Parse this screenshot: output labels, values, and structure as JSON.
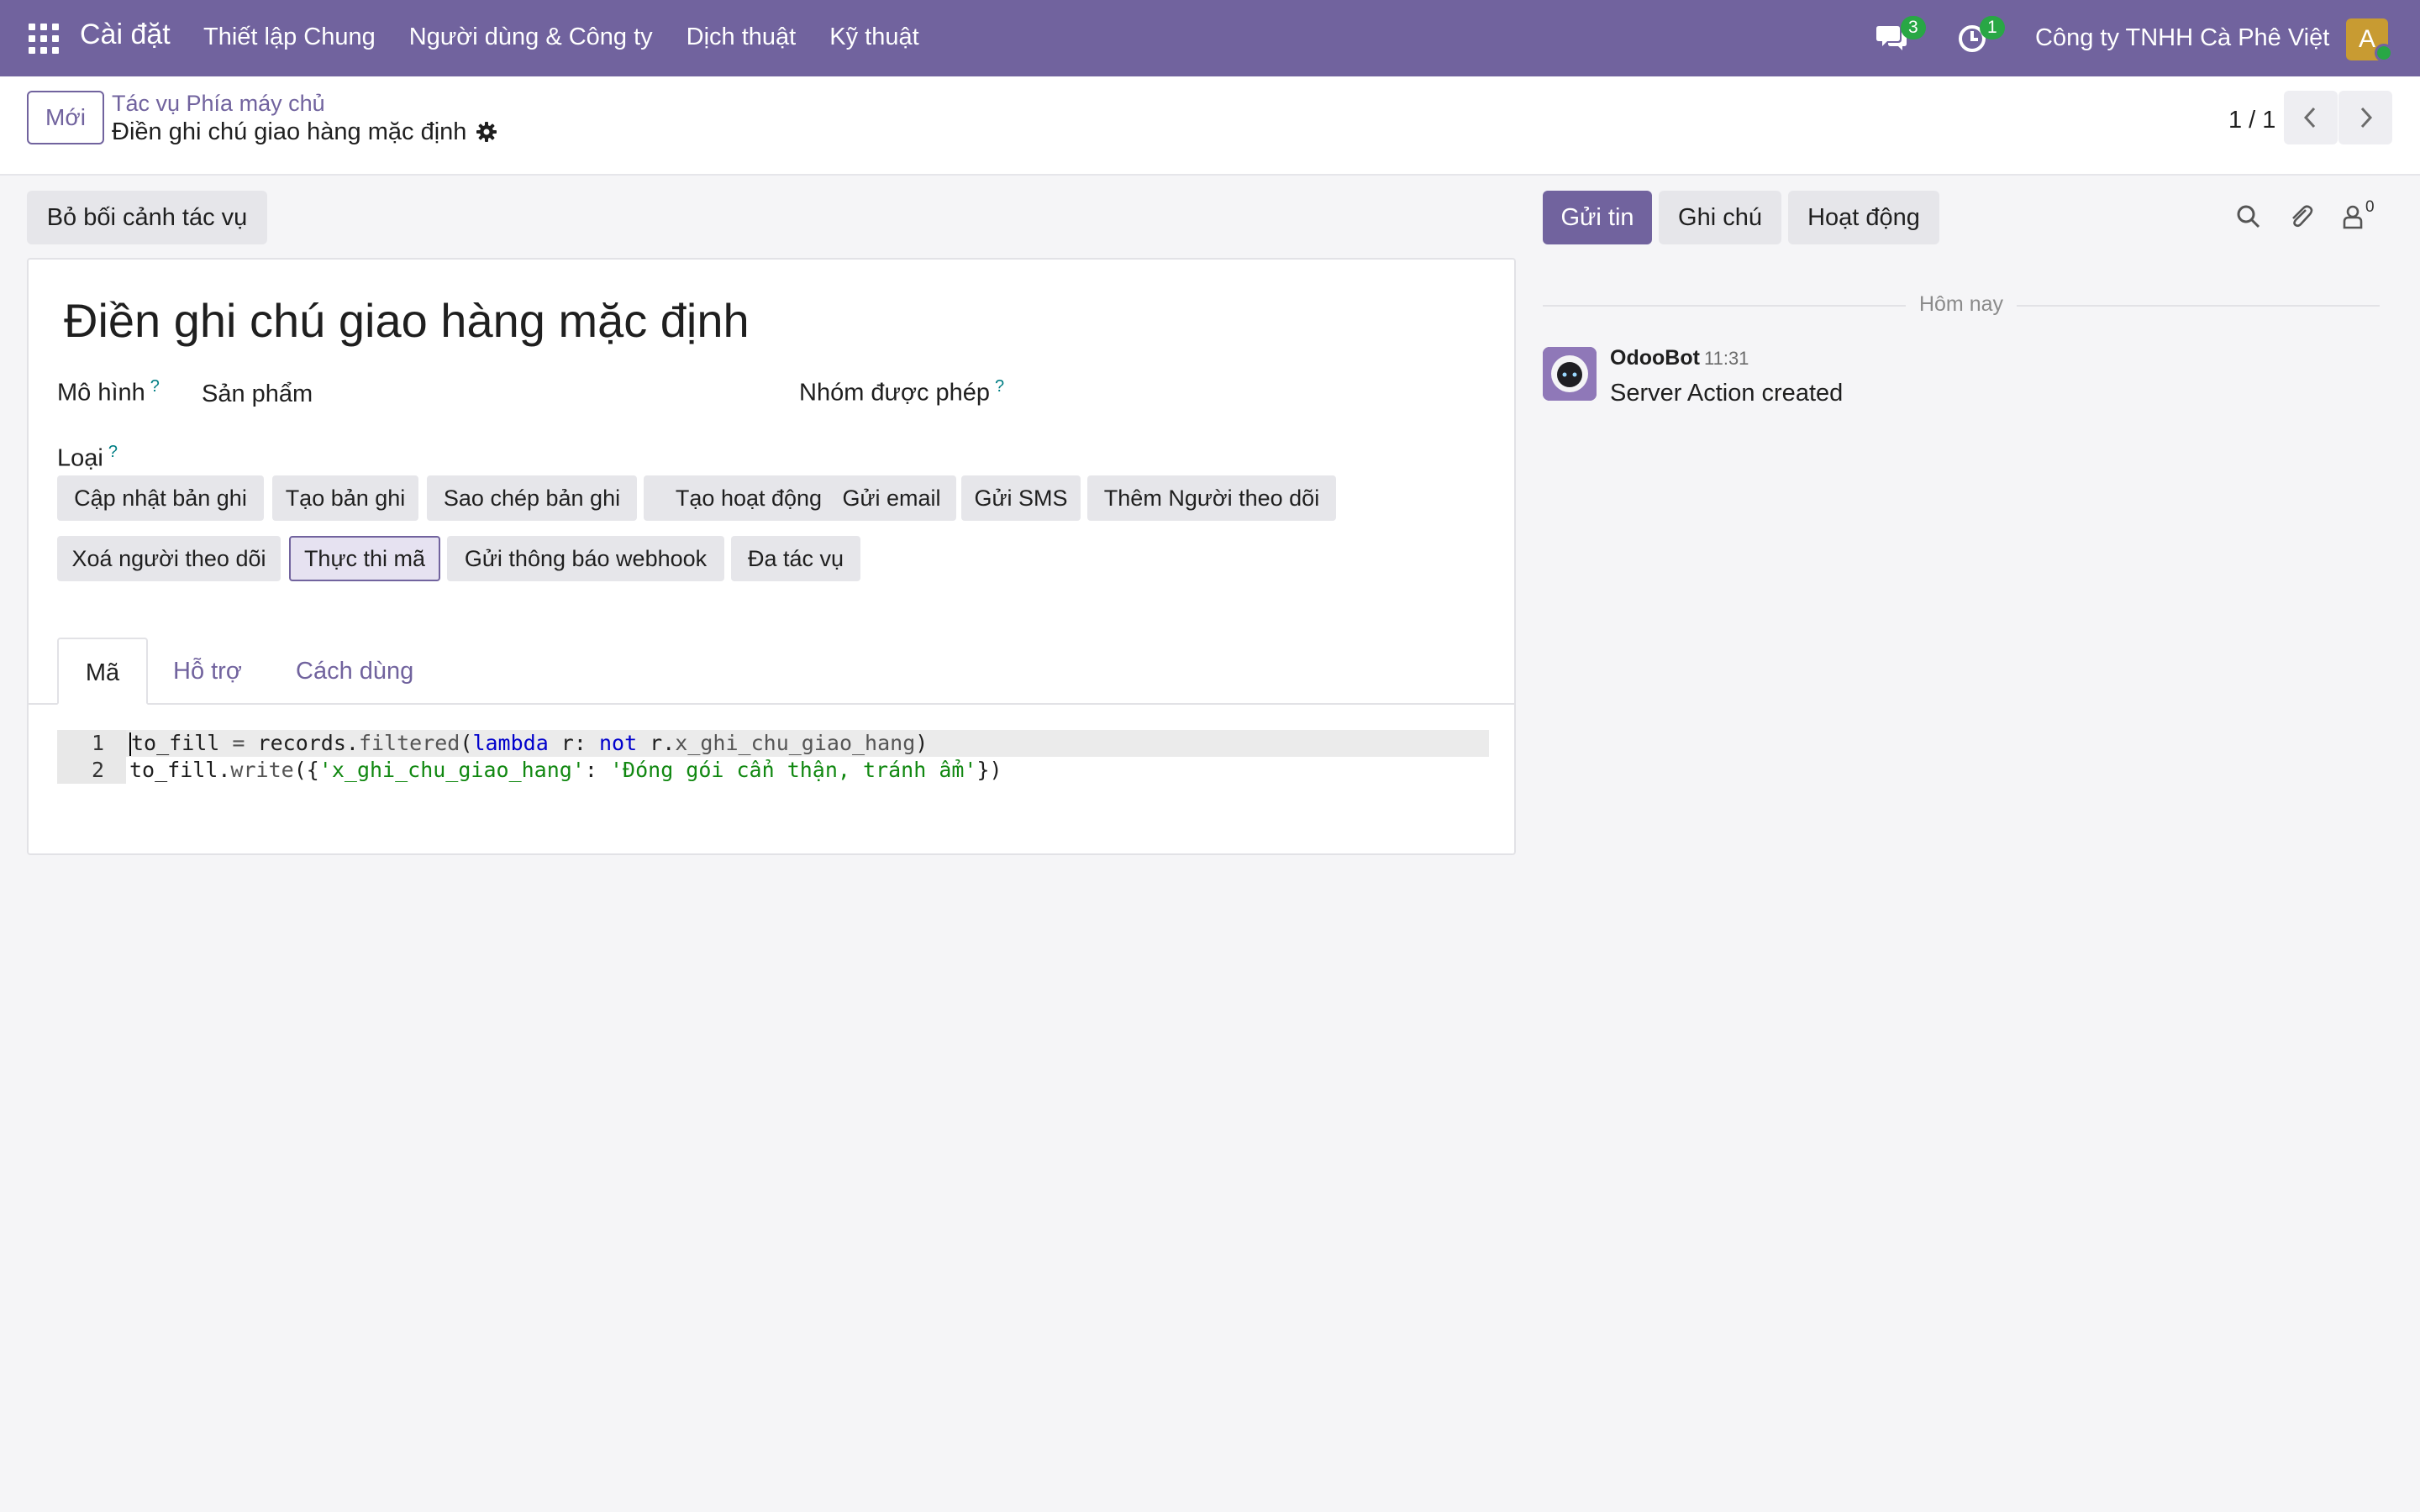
{
  "navbar": {
    "app_title": "Cài đặt",
    "menu": [
      "Thiết lập Chung",
      "Người dùng & Công ty",
      "Dịch thuật",
      "Kỹ thuật"
    ],
    "messages_count": "3",
    "activities_count": "1",
    "company": "Công ty TNHH Cà Phê Việt",
    "avatar_initial": "A",
    "accent_color": "#71639e"
  },
  "control": {
    "new_label": "Mới",
    "breadcrumb_parent": "Tác vụ Phía máy chủ",
    "breadcrumb_current": "Điền ghi chú giao hàng mặc định",
    "pager": "1 / 1"
  },
  "form": {
    "context_button": "Bỏ bối cảnh tác vụ",
    "title": "Điền ghi chú giao hàng mặc định",
    "model_label": "Mô hình",
    "model_value": "Sản phẩm",
    "groups_label": "Nhóm được phép",
    "type_label": "Loại",
    "help_mark": "?",
    "types": [
      "Cập nhật bản ghi",
      "Tạo bản ghi",
      "Sao chép bản ghi",
      "Tạo hoạt động",
      "Gửi email",
      "Gửi SMS",
      "Thêm Người theo dõi",
      "Xoá người theo dõi",
      "Thực thi mã",
      "Gửi thông báo webhook",
      "Đa tác vụ"
    ],
    "selected_type": "Thực thi mã",
    "tabs": [
      "Mã",
      "Hỗ trợ",
      "Cách dùng"
    ],
    "active_tab": "Mã",
    "code_lines": [
      "to_fill = records.filtered(lambda r: not r.x_ghi_chu_giao_hang)",
      "to_fill.write({'x_ghi_chu_giao_hang': 'Đóng gói cẩn thận, tránh ẩm'})"
    ],
    "line_numbers": [
      "1",
      "2"
    ]
  },
  "chatter": {
    "send_label": "Gửi tin",
    "note_label": "Ghi chú",
    "activity_label": "Hoạt động",
    "followers_count": "0",
    "date_divider": "Hôm nay",
    "message": {
      "author": "OdooBot",
      "time": "11:31",
      "body": "Server Action created"
    }
  }
}
